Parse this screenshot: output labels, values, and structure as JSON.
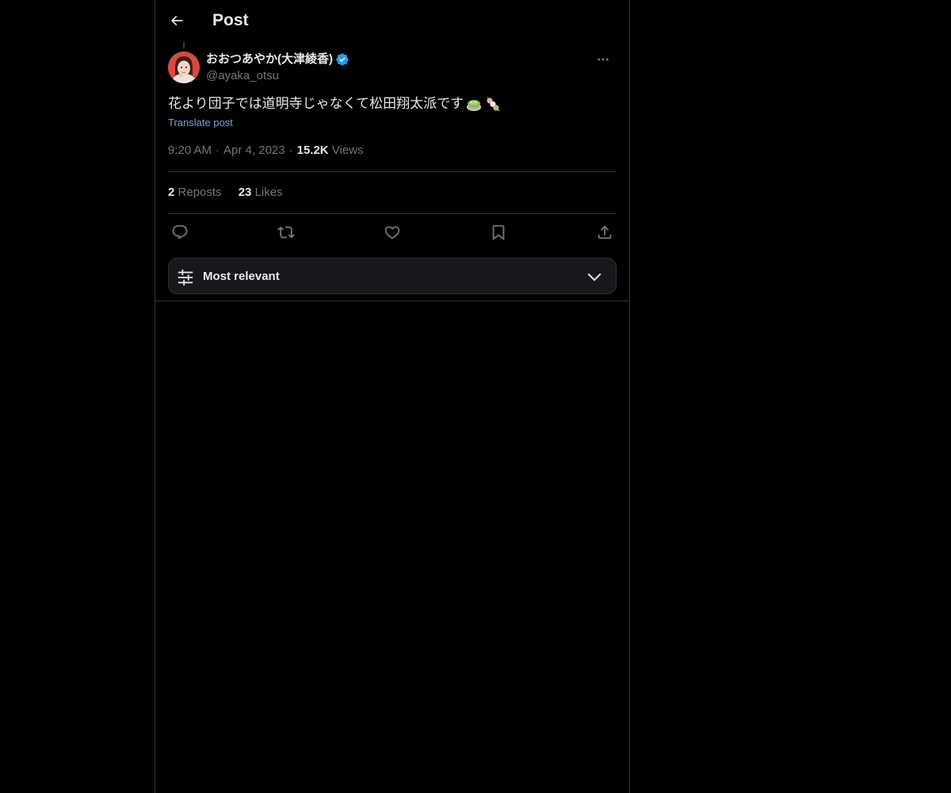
{
  "header": {
    "title": "Post",
    "back_icon": "arrow-left-icon"
  },
  "author": {
    "name": "おおつあやか(大津綾香)",
    "handle": "@ayaka_otsu",
    "verified": true,
    "verified_color": "#1d9bf0"
  },
  "post": {
    "text": "花より団子では道明寺じゃなくて松田翔太派です",
    "emojis": [
      "matcha-dessert-emoji",
      "dango-emoji"
    ],
    "translate_label": "Translate post",
    "time": "9:20 AM",
    "date": "Apr 4, 2023",
    "views_count": "15.2K",
    "views_label": "Views"
  },
  "stats": {
    "reposts_count": "2",
    "reposts_label": "Reposts",
    "likes_count": "23",
    "likes_label": "Likes"
  },
  "actions": [
    "reply-icon",
    "repost-icon",
    "like-icon",
    "bookmark-icon",
    "share-icon"
  ],
  "sort": {
    "label": "Most relevant"
  },
  "colors": {
    "background": "#000000",
    "text_primary": "#e7e9ea",
    "text_secondary": "#71767b",
    "link": "#6ea2d6",
    "border": "#2f3336"
  }
}
